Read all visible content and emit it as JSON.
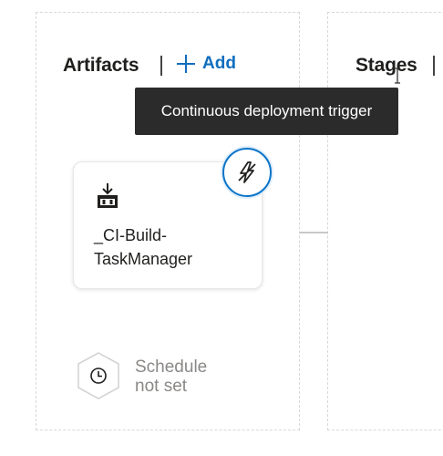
{
  "artifacts_section": {
    "title": "Artifacts",
    "add_label": "Add"
  },
  "stages_section": {
    "title": "Stages"
  },
  "tooltip": {
    "text": "Continuous deployment trigger"
  },
  "artifact_card": {
    "name": "_CI-Build-TaskManager",
    "icon": "build-artifact-icon",
    "trigger_icon": "lightning-trigger-icon"
  },
  "schedule": {
    "line1": "Schedule",
    "line2": "not set",
    "icon": "clock-icon"
  },
  "colors": {
    "accent": "#106ebe",
    "trigger_border": "#0a74c8",
    "tooltip_bg": "#2b2b2b",
    "muted_text": "#8a8886"
  }
}
